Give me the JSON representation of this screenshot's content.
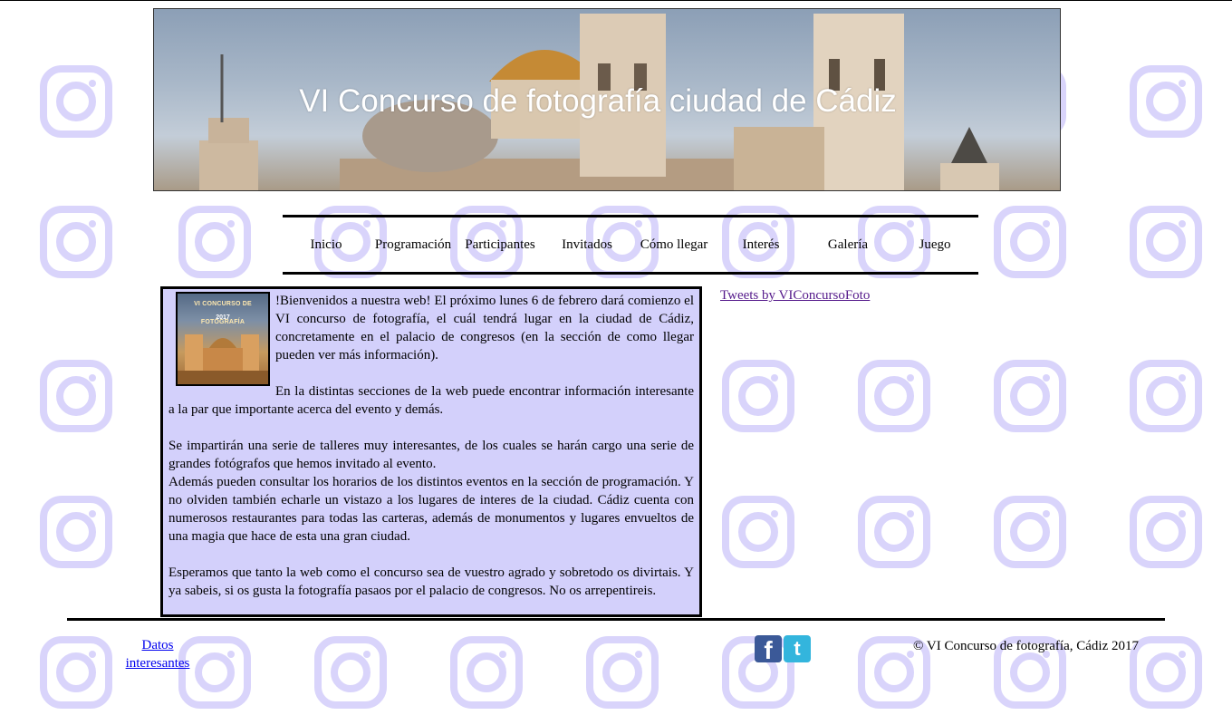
{
  "header": {
    "title": "VI Concurso de fotografía ciudad de Cádiz"
  },
  "nav": {
    "items": [
      "Inicio",
      "Programación",
      "Participantes",
      "Invitados",
      "Cómo llegar",
      "Interés",
      "Galería",
      "Juego"
    ]
  },
  "main": {
    "thumbnail": {
      "caption": "VI CONCURSO DE FOTOGRAFÍA",
      "year": "2017"
    },
    "paragraphs": [
      "!Bienvenidos a nuestra web! El próximo lunes 6 de febrero dará comienzo el VI concurso de fotografía, el cuál tendrá lugar en la ciudad de Cádiz, concretamente en el palacio de congresos (en la sección de como llegar pueden ver más información).",
      "En la distintas secciones de la web puede encontrar información interesante a la par que importante acerca del evento y demás.",
      "Se impartirán una serie de talleres muy interesantes, de los cuales se harán cargo una serie de grandes fotógrafos que hemos invitado al evento.",
      "Además pueden consultar los horarios de los distintos eventos en la sección de programación. Y no olviden también echarle un vistazo a los lugares de interes de la ciudad. Cádiz cuenta con numerosos restaurantes para todas las carteras, además de monumentos y lugares envueltos de una magia que hace de esta una gran ciudad.",
      "Esperamos que tanto la web como el concurso sea de vuestro agrado y sobretodo os divirtais. Y ya sabeis, si os gusta la fotografía pasaos por el palacio de congresos. No os arrepentireis."
    ]
  },
  "sidebar": {
    "tweets_link": "Tweets by VIConcursoFoto"
  },
  "footer": {
    "datos_link": "Datos interesantes",
    "copyright": "© VI Concurso de fotografía, Cádiz 2017",
    "social": {
      "facebook_icon": "facebook-icon",
      "twitter_icon": "twitter-icon",
      "facebook_color": "#3b5998",
      "twitter_color": "#33b5dd"
    }
  },
  "colors": {
    "content_bg": "#d3d0fb",
    "watermark": "#d9d4fb"
  }
}
